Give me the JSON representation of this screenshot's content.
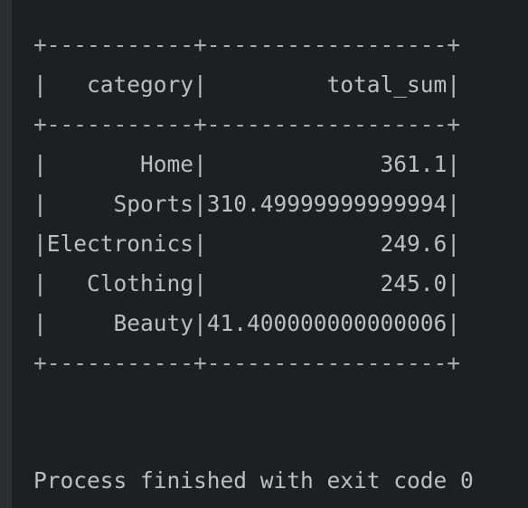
{
  "console": {
    "table_lines": [
      "+-----------+------------------+",
      "|   category|         total_sum|",
      "+-----------+------------------+",
      "|       Home|             361.1|",
      "|     Sports|310.49999999999994|",
      "|Electronics|             249.6|",
      "|   Clothing|             245.0|",
      "|     Beauty|41.400000000000006|",
      "+-----------+------------------+"
    ],
    "status": "Process finished with exit code 0"
  }
}
